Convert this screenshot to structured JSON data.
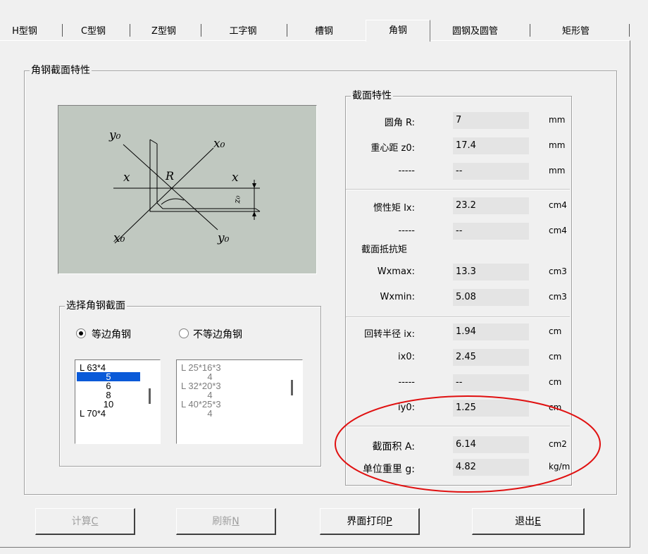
{
  "tabs": [
    {
      "label": "H型钢"
    },
    {
      "label": "C型钢"
    },
    {
      "label": "Z型钢"
    },
    {
      "label": "工字钢"
    },
    {
      "label": "槽钢"
    },
    {
      "label": "角钢"
    },
    {
      "label": "圆钢及圆管"
    },
    {
      "label": "矩形管"
    }
  ],
  "panel": {
    "title": "角钢截面特性"
  },
  "diagram": {
    "y0_top": "y₀",
    "x0_top": "x₀",
    "x_left": "x",
    "R": "R",
    "x_right": "x",
    "z0": "z₀",
    "x0_bottom": "x₀",
    "y0_bottom": "y₀"
  },
  "select": {
    "title": "选择角钢截面",
    "radio_equal": "等边角钢",
    "radio_unequal": "不等边角钢",
    "equal_list": [
      "L 63*4",
      "5",
      "6",
      "8",
      "10",
      "L 70*4"
    ],
    "unequal_list": [
      "L 25*16*3",
      "4",
      "L 32*20*3",
      "4",
      "L 40*25*3",
      "4"
    ]
  },
  "props": {
    "title": "截面特性",
    "section_modulus_title": "截面抵抗矩",
    "rows": [
      {
        "label": "圆角  R:",
        "value": "7",
        "unit": "mm"
      },
      {
        "label": "重心距 z0:",
        "value": "17.4",
        "unit": "mm"
      },
      {
        "label": "-----",
        "value": "--",
        "unit": "mm"
      },
      {
        "label": "惯性矩 Ix:",
        "value": "23.2",
        "unit": "cm4"
      },
      {
        "label": "-----",
        "value": "--",
        "unit": "cm4"
      },
      {
        "label": "Wxmax:",
        "value": "13.3",
        "unit": "cm3"
      },
      {
        "label": "Wxmin:",
        "value": "5.08",
        "unit": "cm3"
      },
      {
        "label": "回转半径 ix:",
        "value": "1.94",
        "unit": "cm"
      },
      {
        "label": "ix0:",
        "value": "2.45",
        "unit": "cm"
      },
      {
        "label": "-----",
        "value": "--",
        "unit": "cm"
      },
      {
        "label": "iy0:",
        "value": "1.25",
        "unit": "cm"
      },
      {
        "label": "截面积 A:",
        "value": "6.14",
        "unit": "cm2"
      },
      {
        "label": "单位重里 g:",
        "value": "4.82",
        "unit": "kg/m"
      }
    ]
  },
  "buttons": {
    "calc": "计算",
    "calc_key": "C",
    "refresh": "刷新",
    "refresh_key": "N",
    "print": "界面打印",
    "print_key": "P",
    "exit": "退出",
    "exit_key": "E"
  },
  "colors": {
    "annotation": "#e01010",
    "selection": "#0a5ad8",
    "diagram_bg": "#c0c8c0"
  }
}
